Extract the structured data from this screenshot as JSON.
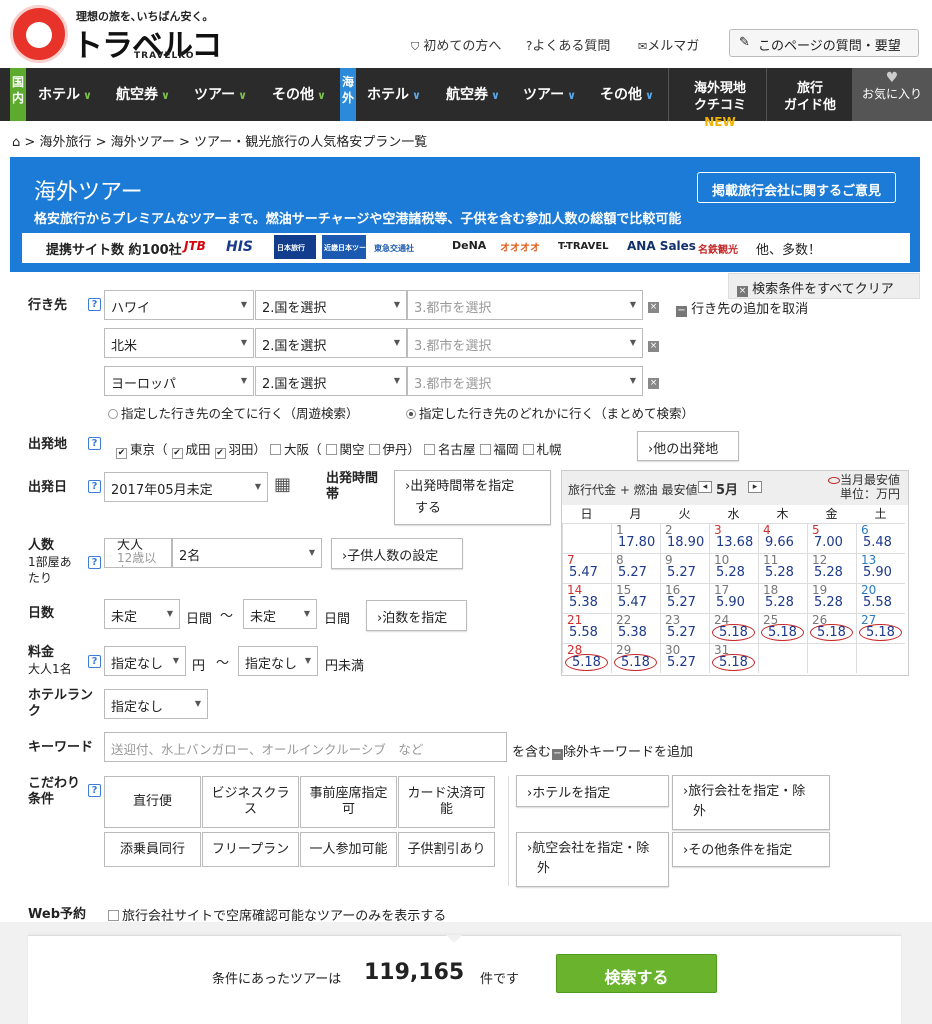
{
  "header": {
    "tagline": "理想の旅を､いちばん安く｡",
    "logo": "トラベルコ",
    "logo_sub": "TRAVELKO",
    "links": [
      "初めての方へ",
      "よくある質問",
      "メルマガ"
    ],
    "feedback_button": "このページの質問・要望"
  },
  "nav": {
    "domestic_tag": "国内",
    "overseas_tag": "海外",
    "domestic_items": [
      "ホテル",
      "航空券",
      "ツアー",
      "その他"
    ],
    "overseas_items": [
      "ホテル",
      "航空券",
      "ツアー",
      "その他"
    ],
    "review_line1": "海外現地",
    "review_line2": "クチコミ",
    "review_new": "NEW",
    "guide_line1": "旅行",
    "guide_line2": "ガイド他",
    "favorites": "お気に入り"
  },
  "breadcrumb": [
    "海外旅行",
    "海外ツアー",
    "ツアー・観光旅行の人気格安プラン一覧"
  ],
  "banner": {
    "title": "海外ツアー",
    "subtitle": "格安旅行からプレミアムなツアーまで。燃油サーチャージや空港諸税等、子供を含む参加人数の総額で比較可能",
    "opinion_button": "掲載旅行会社に関するご意見",
    "partners_label": "提携サイト数 約100社",
    "partners_more": "他、多数！",
    "partner_logos": [
      "JTB",
      "HIS",
      "日本旅行",
      "近畿日本ツーリスト",
      "東急交通社",
      "DeNA",
      "オオオオ",
      "T-TRAVEL",
      "ANA Sales",
      "名鉄観光"
    ]
  },
  "clear_button": "検索条件をすべてクリア",
  "destination": {
    "label": "行き先",
    "rows": [
      {
        "region": "ハワイ",
        "country": "2.国を選択",
        "city": "3.都市を選択"
      },
      {
        "region": "北米",
        "country": "2.国を選択",
        "city": "3.都市を選択"
      },
      {
        "region": "ヨーロッパ",
        "country": "2.国を選択",
        "city": "3.都市を選択"
      }
    ],
    "cancel_add": "行き先の追加を取消",
    "radio_all": "指定した行き先の全てに行く（周遊検索）",
    "radio_any": "指定した行き先のどれかに行く（まとめて検索）"
  },
  "departure_place": {
    "label": "出発地",
    "tokyo": "東京（",
    "narita": "成田",
    "haneda": "羽田）",
    "osaka": "大阪（",
    "kansai": "関空",
    "itami": "伊丹）",
    "nagoya": "名古屋",
    "fukuoka": "福岡",
    "sapporo": "札幌",
    "other_button": "他の出発地"
  },
  "departure_date": {
    "label": "出発日",
    "value": "2017年05月未定",
    "time_label_1": "出発時間",
    "time_label_2": "帯",
    "time_button_1": "出発時間帯を指定",
    "time_button_2": "する"
  },
  "calendar": {
    "header": "旅行代金 + 燃油 最安値",
    "month": "5月",
    "legend_1": "当月最安値",
    "legend_2": "単位：万円",
    "days_of_week": [
      "日",
      "月",
      "火",
      "水",
      "木",
      "金",
      "土"
    ],
    "weeks": [
      [
        null,
        {
          "d": "1",
          "p": "17.80"
        },
        {
          "d": "2",
          "p": "18.90"
        },
        {
          "d": "3",
          "p": "13.68",
          "hol": true
        },
        {
          "d": "4",
          "p": "9.66",
          "hol": true
        },
        {
          "d": "5",
          "p": "7.00",
          "hol": true
        },
        {
          "d": "6",
          "p": "5.48"
        }
      ],
      [
        {
          "d": "7",
          "p": "5.47"
        },
        {
          "d": "8",
          "p": "5.27"
        },
        {
          "d": "9",
          "p": "5.27"
        },
        {
          "d": "10",
          "p": "5.28"
        },
        {
          "d": "11",
          "p": "5.28"
        },
        {
          "d": "12",
          "p": "5.28"
        },
        {
          "d": "13",
          "p": "5.90"
        }
      ],
      [
        {
          "d": "14",
          "p": "5.38"
        },
        {
          "d": "15",
          "p": "5.47"
        },
        {
          "d": "16",
          "p": "5.27"
        },
        {
          "d": "17",
          "p": "5.90"
        },
        {
          "d": "18",
          "p": "5.28"
        },
        {
          "d": "19",
          "p": "5.28"
        },
        {
          "d": "20",
          "p": "5.58"
        }
      ],
      [
        {
          "d": "21",
          "p": "5.58"
        },
        {
          "d": "22",
          "p": "5.38"
        },
        {
          "d": "23",
          "p": "5.27"
        },
        {
          "d": "24",
          "p": "5.18",
          "low": true
        },
        {
          "d": "25",
          "p": "5.18",
          "low": true
        },
        {
          "d": "26",
          "p": "5.18",
          "low": true
        },
        {
          "d": "27",
          "p": "5.18",
          "low": true
        }
      ],
      [
        {
          "d": "28",
          "p": "5.18",
          "low": true
        },
        {
          "d": "29",
          "p": "5.18",
          "low": true
        },
        {
          "d": "30",
          "p": "5.27"
        },
        {
          "d": "31",
          "p": "5.18",
          "low": true
        },
        null,
        null,
        null
      ]
    ]
  },
  "people": {
    "label": "人数",
    "sub1": "1部屋あ",
    "sub2": "たり",
    "adult_1": "大人",
    "adult_2": "12歳以",
    "adult_3": "上",
    "value": "2名",
    "child_button": "子供人数の設定"
  },
  "days": {
    "label": "日数",
    "from": "未定",
    "unit": "日間",
    "tilde": "〜",
    "to": "未定",
    "unit2": "日間",
    "nights_button": "泊数を指定"
  },
  "price": {
    "label": "料金",
    "sub": "大人1名",
    "from": "指定なし",
    "unit": "円",
    "tilde": "〜",
    "to": "指定なし",
    "unit2": "円未満"
  },
  "hotel_rank": {
    "label_1": "ホテルラン",
    "label_2": "ク",
    "value": "指定なし"
  },
  "keyword": {
    "label": "キーワード",
    "placeholder": "送迎付、水上バンガロー、オールインクルーシブ　など",
    "suffix": "を含む",
    "exclude": "除外キーワードを追加"
  },
  "preferences": {
    "label_1": "こだわり",
    "label_2": "条件",
    "options": [
      [
        "直行便"
      ],
      [
        "ビジネスクラ",
        "ス"
      ],
      [
        "事前座席指定",
        "可"
      ],
      [
        "カード決済可",
        "能"
      ],
      [
        "添乗員同行"
      ],
      [
        "フリープラン"
      ],
      [
        "一人参加可能"
      ],
      [
        "子供割引あり"
      ]
    ],
    "hotel_button": "ホテルを指定",
    "agency_button_1": "旅行会社を指定・除",
    "agency_button_2": "外",
    "airline_button_1": "航空会社を指定・除",
    "airline_button_2": "外",
    "other_button": "その他条件を指定"
  },
  "web": {
    "label": "Web予約",
    "checkbox": "旅行会社サイトで空席確認可能なツアーのみを表示する"
  },
  "result": {
    "prefix": "条件にあったツアーは",
    "count": "119,165",
    "suffix": "件です",
    "search_button": "検索する"
  }
}
